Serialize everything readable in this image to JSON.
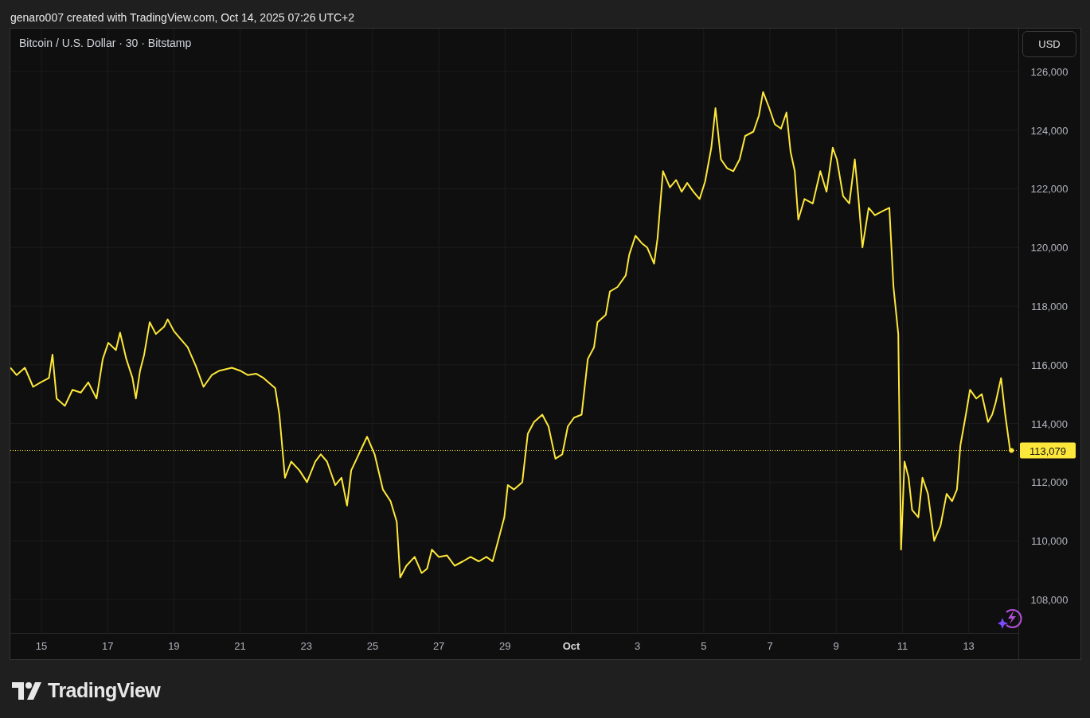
{
  "header": {
    "text": "genaro007 created with TradingView.com, Oct 14, 2025 07:26 UTC+2"
  },
  "chart": {
    "currency_button": "USD",
    "chart_data": {
      "type": "line",
      "title": "Bitcoin / U.S. Dollar · 30 · Bitstamp",
      "grid": true,
      "x": [
        "2025-09-14T01:30",
        "2025-09-14T06:00",
        "2025-09-14T12:00",
        "2025-09-14T18:00",
        "2025-09-14T23:30",
        "2025-09-15T05:30",
        "2025-09-15T08:00",
        "2025-09-15T11:00",
        "2025-09-15T17:00",
        "2025-09-15T22:30",
        "2025-09-16T04:30",
        "2025-09-16T10:00",
        "2025-09-16T16:00",
        "2025-09-16T20:30",
        "2025-09-17T00:30",
        "2025-09-17T06:00",
        "2025-09-17T09:00",
        "2025-09-17T13:30",
        "2025-09-17T18:00",
        "2025-09-17T20:30",
        "2025-09-17T23:30",
        "2025-09-18T02:30",
        "2025-09-18T06:30",
        "2025-09-18T11:00",
        "2025-09-18T17:00",
        "2025-09-18T19:30",
        "2025-09-19T00:00",
        "2025-09-19T04:30",
        "2025-09-19T10:00",
        "2025-09-19T16:00",
        "2025-09-19T21:30",
        "2025-09-20T03:30",
        "2025-09-20T09:00",
        "2025-09-20T18:00",
        "2025-09-21T00:00",
        "2025-09-21T05:30",
        "2025-09-21T11:30",
        "2025-09-21T17:00",
        "2025-09-22T01:30",
        "2025-09-22T04:30",
        "2025-09-22T08:30",
        "2025-09-22T13:00",
        "2025-09-22T19:00",
        "2025-09-23T00:30",
        "2025-09-23T06:30",
        "2025-09-23T10:30",
        "2025-09-23T15:00",
        "2025-09-23T21:00",
        "2025-09-24T01:30",
        "2025-09-24T05:30",
        "2025-09-24T08:30",
        "2025-09-24T14:00",
        "2025-09-24T20:00",
        "2025-09-25T01:30",
        "2025-09-25T07:30",
        "2025-09-25T13:00",
        "2025-09-25T17:30",
        "2025-09-25T20:00",
        "2025-09-26T00:30",
        "2025-09-26T06:30",
        "2025-09-26T11:30",
        "2025-09-26T15:30",
        "2025-09-26T19:00",
        "2025-09-27T00:00",
        "2025-09-27T06:00",
        "2025-09-27T11:30",
        "2025-09-27T17:30",
        "2025-09-27T23:00",
        "2025-09-28T05:00",
        "2025-09-28T10:30",
        "2025-09-28T15:00",
        "2025-09-28T19:00",
        "2025-09-28T23:30",
        "2025-09-29T02:00",
        "2025-09-29T06:30",
        "2025-09-29T12:30",
        "2025-09-29T16:30",
        "2025-09-29T21:00",
        "2025-09-30T03:00",
        "2025-09-30T07:30",
        "2025-09-30T12:30",
        "2025-09-30T17:30",
        "2025-09-30T21:30",
        "2025-10-01T02:00",
        "2025-10-01T07:30",
        "2025-10-01T12:00",
        "2025-10-01T16:30",
        "2025-10-01T19:00",
        "2025-10-02T01:00",
        "2025-10-02T04:00",
        "2025-10-02T09:30",
        "2025-10-02T15:30",
        "2025-10-02T18:00",
        "2025-10-02T22:30",
        "2025-10-03T03:00",
        "2025-10-03T07:00",
        "2025-10-03T12:00",
        "2025-10-03T14:30",
        "2025-10-03T18:30",
        "2025-10-03T23:30",
        "2025-10-04T04:00",
        "2025-10-04T08:00",
        "2025-10-04T12:00",
        "2025-10-04T16:30",
        "2025-10-04T21:00",
        "2025-10-05T01:00",
        "2025-10-05T05:30",
        "2025-10-05T08:30",
        "2025-10-05T12:30",
        "2025-10-05T17:00",
        "2025-10-05T21:30",
        "2025-10-06T02:00",
        "2025-10-06T06:00",
        "2025-10-06T12:00",
        "2025-10-06T16:00",
        "2025-10-06T19:00",
        "2025-10-06T23:30",
        "2025-10-07T03:30",
        "2025-10-07T08:00",
        "2025-10-07T12:00",
        "2025-10-07T15:00",
        "2025-10-07T18:00",
        "2025-10-07T20:30",
        "2025-10-08T01:00",
        "2025-10-08T07:00",
        "2025-10-08T12:30",
        "2025-10-08T17:00",
        "2025-10-08T21:30",
        "2025-10-09T00:30",
        "2025-10-09T05:00",
        "2025-10-09T09:30",
        "2025-10-09T13:30",
        "2025-10-09T16:00",
        "2025-10-09T19:00",
        "2025-10-09T23:30",
        "2025-10-10T04:00",
        "2025-10-10T10:00",
        "2025-10-10T14:30",
        "2025-10-10T17:30",
        "2025-10-10T21:00",
        "2025-10-10T23:00",
        "2025-10-11T01:30",
        "2025-10-11T04:30",
        "2025-10-11T07:00",
        "2025-10-11T11:30",
        "2025-10-11T14:30",
        "2025-10-11T18:30",
        "2025-10-11T23:00",
        "2025-10-12T03:30",
        "2025-10-12T08:00",
        "2025-10-12T12:00",
        "2025-10-12T15:30",
        "2025-10-12T18:00",
        "2025-10-12T22:00",
        "2025-10-13T01:00",
        "2025-10-13T05:30",
        "2025-10-13T09:30",
        "2025-10-13T14:00",
        "2025-10-13T17:00",
        "2025-10-13T19:30",
        "2025-10-13T23:30",
        "2025-10-14T02:30",
        "2025-10-14T06:00",
        "2025-10-14T07:00"
      ],
      "series": [
        {
          "color": "#fde73a",
          "values": [
            115900,
            115650,
            115900,
            115250,
            115400,
            115550,
            116350,
            114850,
            114600,
            115150,
            115050,
            115400,
            114850,
            116200,
            116750,
            116500,
            117100,
            116200,
            115550,
            114850,
            115800,
            116350,
            117450,
            117050,
            117300,
            117550,
            117150,
            116900,
            116600,
            115950,
            115250,
            115650,
            115800,
            115900,
            115800,
            115650,
            115700,
            115550,
            115200,
            114300,
            112150,
            112700,
            112400,
            112000,
            112700,
            112950,
            112700,
            111900,
            112150,
            111200,
            112400,
            112950,
            113550,
            112950,
            111750,
            111350,
            110650,
            108750,
            109150,
            109450,
            108900,
            109050,
            109700,
            109450,
            109500,
            109150,
            109300,
            109450,
            109300,
            109450,
            109300,
            110000,
            110800,
            111900,
            111750,
            112000,
            113650,
            114050,
            114300,
            113900,
            112800,
            112950,
            113900,
            114200,
            114300,
            116200,
            116600,
            117450,
            117700,
            118500,
            118650,
            119050,
            119750,
            120400,
            120150,
            120000,
            119450,
            120300,
            122600,
            122050,
            122300,
            121900,
            122200,
            121900,
            121650,
            122250,
            123400,
            124750,
            123000,
            122700,
            122600,
            123000,
            123800,
            123950,
            124500,
            125300,
            124750,
            124200,
            124050,
            124600,
            123250,
            122600,
            120950,
            121650,
            121500,
            122600,
            121900,
            123400,
            123000,
            121750,
            121500,
            123000,
            121750,
            120000,
            121350,
            121100,
            121250,
            121350,
            118650,
            117050,
            109700,
            112700,
            112150,
            111050,
            110800,
            112150,
            111600,
            110000,
            110500,
            111600,
            111350,
            111750,
            113250,
            114300,
            115150,
            114850,
            115000,
            114050,
            114300,
            114700,
            115550,
            114300,
            113100,
            113080
          ]
        }
      ],
      "xlim": [
        "2025-09-14T01:30",
        "2025-10-14T12:00"
      ],
      "ylim": [
        106860,
        127460
      ],
      "xticks": [
        {
          "value": "2025-09-15",
          "label": "15"
        },
        {
          "value": "2025-09-17",
          "label": "17"
        },
        {
          "value": "2025-09-19",
          "label": "19"
        },
        {
          "value": "2025-09-21",
          "label": "21"
        },
        {
          "value": "2025-09-23",
          "label": "23"
        },
        {
          "value": "2025-09-25",
          "label": "25"
        },
        {
          "value": "2025-09-27",
          "label": "27"
        },
        {
          "value": "2025-09-29",
          "label": "29"
        },
        {
          "value": "2025-10-01",
          "label": "Oct"
        },
        {
          "value": "2025-10-03",
          "label": "3"
        },
        {
          "value": "2025-10-05",
          "label": "5"
        },
        {
          "value": "2025-10-07",
          "label": "7"
        },
        {
          "value": "2025-10-09",
          "label": "9"
        },
        {
          "value": "2025-10-11",
          "label": "11"
        },
        {
          "value": "2025-10-13",
          "label": "13"
        }
      ],
      "yticks": [
        {
          "value": 108000,
          "label": "108,000"
        },
        {
          "value": 110000,
          "label": "110,000"
        },
        {
          "value": 112000,
          "label": "112,000"
        },
        {
          "value": 114000,
          "label": "114,000"
        },
        {
          "value": 116000,
          "label": "116,000"
        },
        {
          "value": 118000,
          "label": "118,000"
        },
        {
          "value": 120000,
          "label": "120,000"
        },
        {
          "value": 122000,
          "label": "122,000"
        },
        {
          "value": 124000,
          "label": "124,000"
        },
        {
          "value": 126000,
          "label": "126,000"
        }
      ],
      "ref_lines": [
        {
          "axis": "y",
          "value": 113079,
          "label": "113,079"
        }
      ]
    }
  },
  "footer": {
    "logo": "TradingView"
  }
}
